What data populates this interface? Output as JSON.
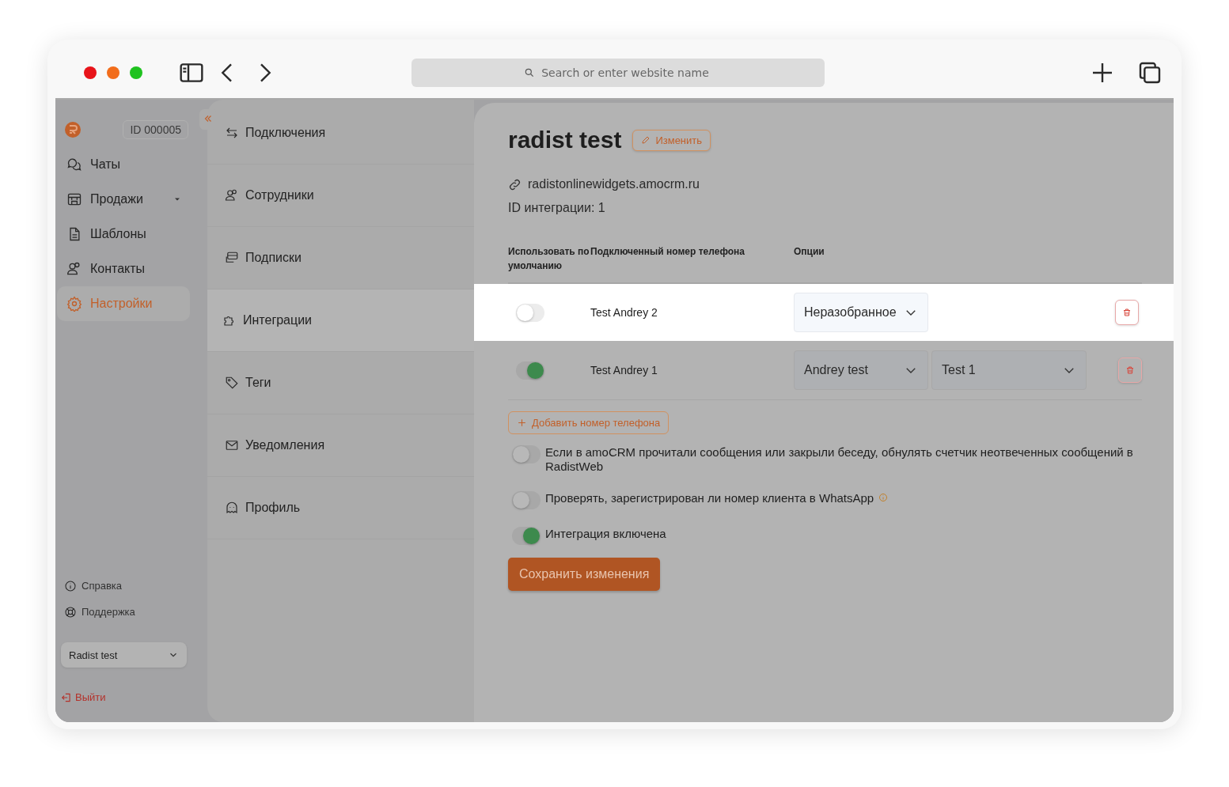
{
  "browser": {
    "search": {
      "placeholder": "Search or enter website name"
    }
  },
  "sidebar": {
    "account_id": "ID 000005",
    "items": [
      {
        "label": "Чаты",
        "selected": false,
        "has_submenu": false
      },
      {
        "label": "Продажи",
        "selected": false,
        "has_submenu": true
      },
      {
        "label": "Шаблоны",
        "selected": false,
        "has_submenu": false
      },
      {
        "label": "Контакты",
        "selected": false,
        "has_submenu": false
      },
      {
        "label": "Настройки",
        "selected": true,
        "has_submenu": false
      }
    ],
    "footer_links": [
      {
        "label": "Справка"
      },
      {
        "label": "Поддержка"
      }
    ],
    "workspace": {
      "value": "Radist test"
    },
    "logout": "Выйти"
  },
  "settings_menu": [
    {
      "label": "Подключения",
      "selected": false
    },
    {
      "label": "Сотрудники",
      "selected": false
    },
    {
      "label": "Подписки",
      "selected": false
    },
    {
      "label": "Интеграции",
      "selected": true
    },
    {
      "label": "Теги",
      "selected": false
    },
    {
      "label": "Уведомления",
      "selected": false
    },
    {
      "label": "Профиль",
      "selected": false
    }
  ],
  "main": {
    "title": "radist test",
    "edit_button": "Изменить",
    "domain": "radistonlinewidgets.amocrm.ru",
    "integration_id": "ID интеграции: 1",
    "table": {
      "columns": [
        "Использовать по умолчанию",
        "Подключенный номер телефона",
        "Опции"
      ],
      "rows": [
        {
          "default": false,
          "phone": "Test Andrey 2",
          "options": [
            "Неразобранное"
          ],
          "highlighted": true
        },
        {
          "default": true,
          "phone": "Test Andrey 1",
          "options": [
            "Andrey test",
            "Test 1"
          ],
          "highlighted": false
        }
      ]
    },
    "add_button": "Добавить номер телефона",
    "settings": [
      {
        "label": "Если в amoCRM прочитали сообщения или закрыли беседу, обнулять счетчик неотвеченных сообщений в RadistWeb",
        "on": false,
        "info": false
      },
      {
        "label": "Проверять, зарегистрирован ли номер клиента в WhatsApp",
        "on": false,
        "info": true
      },
      {
        "label": "Интеграция включена",
        "on": true,
        "info": false
      }
    ],
    "save_button": "Сохранить изменения"
  }
}
